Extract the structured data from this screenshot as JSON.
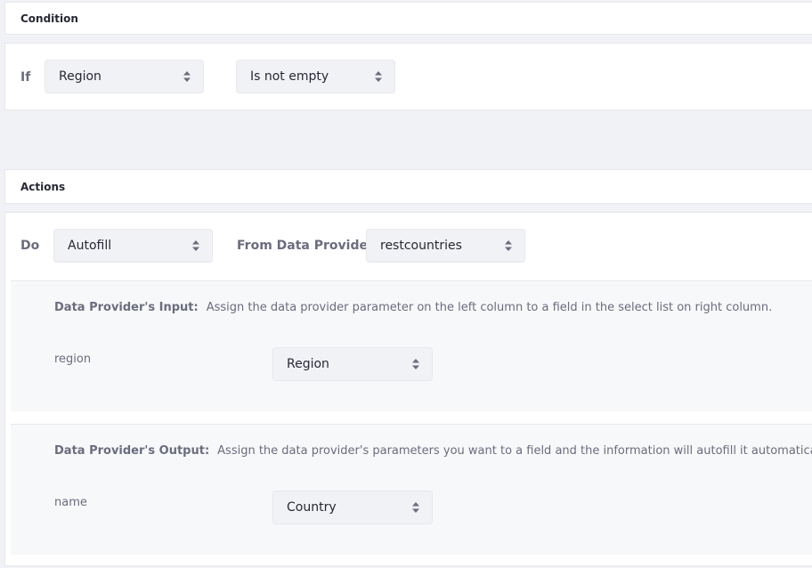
{
  "condition": {
    "header": "Condition",
    "if_label": "If",
    "field_select": "Region",
    "operator_select": "Is not empty"
  },
  "actions": {
    "header": "Actions",
    "do_label": "Do",
    "action_select": "Autofill",
    "provider_label": "From Data Provider",
    "provider_select": "restcountries",
    "input": {
      "title": "Data Provider's Input:",
      "description": "Assign the data provider parameter on the left column to a field in the select list on right column.",
      "param_name": "region",
      "field_select": "Region"
    },
    "output": {
      "title": "Data Provider's Output:",
      "description": "Assign the data provider's parameters you want to a field and the information will autofill it automatically.",
      "param_name": "name",
      "field_select": "Country"
    }
  },
  "icons": {
    "select_arrows": "caret-double-icon"
  }
}
